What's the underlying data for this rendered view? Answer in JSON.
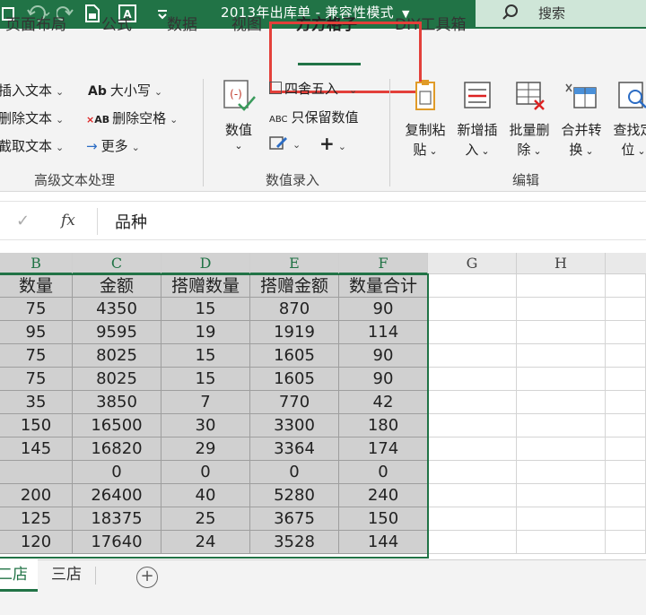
{
  "titlebar": {
    "title": "2013年出库单  -  兼容性模式",
    "search_label": "搜索"
  },
  "ribbon_tabs": [
    {
      "label": "页面布局",
      "active": false
    },
    {
      "label": "公式",
      "active": false
    },
    {
      "label": "数据",
      "active": false
    },
    {
      "label": "视图",
      "active": false
    },
    {
      "label": "方方格子",
      "active": true
    },
    {
      "label": "DIY工具箱",
      "active": false
    }
  ],
  "ribbon": {
    "text_group": {
      "items": [
        "插入文本",
        "删除文本",
        "截取文本"
      ],
      "mid_items": [
        "大小写",
        "删除空格",
        "更多"
      ],
      "label": "高级文本处理"
    },
    "value_group": {
      "big_button": "数值",
      "items": [
        "四舍五入",
        "只保留数值"
      ],
      "label": "数值录入"
    },
    "edit_group": {
      "buttons": [
        {
          "line1": "复制粘",
          "line2": "贴"
        },
        {
          "line1": "新增插",
          "line2": "入"
        },
        {
          "line1": "批量删",
          "line2": "除"
        },
        {
          "line1": "合并转",
          "line2": "换"
        },
        {
          "line1": "查找定",
          "line2": "位"
        }
      ],
      "label": "编辑"
    }
  },
  "formula_bar": {
    "fx": "fx",
    "value": "品种"
  },
  "columns": [
    "B",
    "C",
    "D",
    "E",
    "F",
    "G",
    "H"
  ],
  "table": {
    "headers": [
      "数量",
      "金额",
      "搭赠数量",
      "搭赠金额",
      "数量合计"
    ],
    "rows": [
      [
        "75",
        "4350",
        "15",
        "870",
        "90"
      ],
      [
        "95",
        "9595",
        "19",
        "1919",
        "114"
      ],
      [
        "75",
        "8025",
        "15",
        "1605",
        "90"
      ],
      [
        "75",
        "8025",
        "15",
        "1605",
        "90"
      ],
      [
        "35",
        "3850",
        "7",
        "770",
        "42"
      ],
      [
        "150",
        "16500",
        "30",
        "3300",
        "180"
      ],
      [
        "145",
        "16820",
        "29",
        "3364",
        "174"
      ],
      [
        "",
        "0",
        "0",
        "0",
        "0"
      ],
      [
        "200",
        "26400",
        "40",
        "5280",
        "240"
      ],
      [
        "125",
        "18375",
        "25",
        "3675",
        "150"
      ],
      [
        "120",
        "17640",
        "24",
        "3528",
        "144"
      ]
    ]
  },
  "sheets": [
    {
      "label": "二店",
      "active": true
    },
    {
      "label": "三店",
      "active": false
    }
  ],
  "colors": {
    "accent": "#217346",
    "highlight": "#e3403a",
    "selection": "#d0d0d0"
  }
}
